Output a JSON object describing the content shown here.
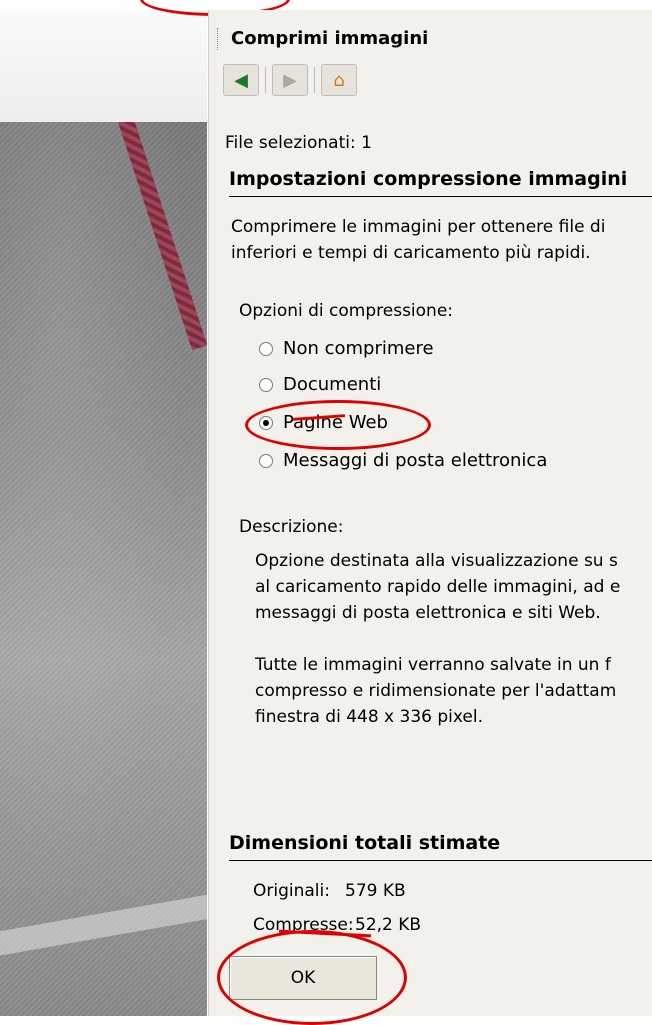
{
  "pane": {
    "title": "Comprimi immagini",
    "selected_files": "File selezionati: 1",
    "compression_section": "Impostazioni compressione immagini",
    "intro_line1": "Comprimere le immagini per ottenere file di",
    "intro_line2": "inferiori e tempi di caricamento più rapidi.",
    "options_label": "Opzioni di compressione:",
    "options": [
      {
        "label": "Non comprimere",
        "checked": false
      },
      {
        "label": "Documenti",
        "checked": false
      },
      {
        "label": "Pagine Web",
        "checked": true
      },
      {
        "label": "Messaggi di posta elettronica",
        "checked": false
      }
    ],
    "description_label": "Descrizione:",
    "desc_line1": "Opzione destinata alla visualizzazione su s",
    "desc_line2": "al caricamento rapido delle immagini, ad e",
    "desc_line3": "messaggi di posta elettronica e siti Web.",
    "desc_line4": "Tutte le immagini verranno salvate in un f",
    "desc_line5": "compresso e ridimensionate per l'adattam",
    "desc_line6": "finestra di 448 x 336 pixel.",
    "size_section": "Dimensioni totali stimate",
    "original_label": "Originali:",
    "original_value": "579 KB",
    "compressed_label": "Compresse:",
    "compressed_value": "52,2 KB",
    "ok_button": "OK"
  },
  "icons": {
    "back": "back-arrow-icon",
    "forward": "forward-arrow-icon",
    "home": "home-icon"
  },
  "colors": {
    "annotation": "#e00000",
    "pane_bg": "#f2f1ec"
  }
}
